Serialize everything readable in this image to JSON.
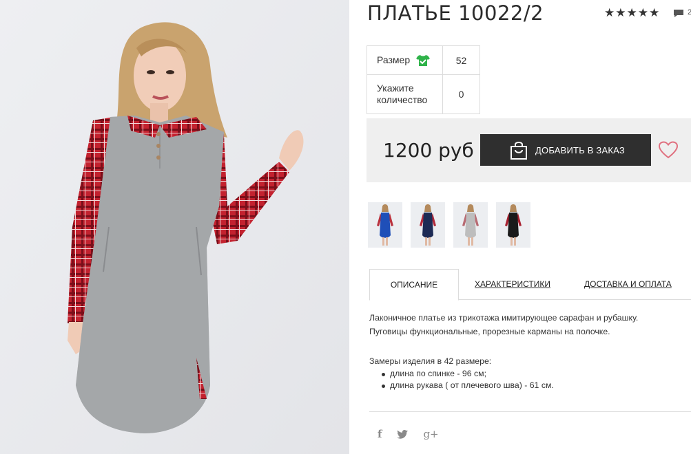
{
  "product": {
    "title": "ПЛАТЬЕ 10022/2",
    "rating_stars": "★★★★★",
    "comment_count": "2"
  },
  "options": {
    "size_label": "Размер",
    "size_value": "52",
    "quantity_label": "Укажите количество",
    "quantity_value": "0"
  },
  "purchase": {
    "price": "1200 руб",
    "add_button_label": "ДОБАВИТЬ В ЗАКАЗ"
  },
  "tabs": [
    {
      "label": "ОПИСАНИЕ"
    },
    {
      "label": "ХАРАКТЕРИСТИКИ"
    },
    {
      "label": "ДОСТАВКА И ОПЛАТА"
    }
  ],
  "description": {
    "line1": "Лаконичное платье из трикотажа имитирующее сарафан и рубашку.",
    "line2": "Пуговицы функциональные, прорезные карманы на полочке.",
    "measurements_title": "Замеры изделия в 42 размере:",
    "items": [
      "длина по спинке - 96 см;",
      "длина рукава ( от плечевого шва) - 61 см."
    ]
  },
  "social": {
    "facebook": "f",
    "twitter": "t",
    "googleplus": "g+"
  },
  "thumbnails": [
    {
      "dress_color": "#1f4fb8",
      "sleeve_color": "#b8323f"
    },
    {
      "dress_color": "#1d2b55",
      "sleeve_color": "#b0283a"
    },
    {
      "dress_color": "#bdbdbd",
      "sleeve_color": "#b86a72"
    },
    {
      "dress_color": "#1a1a1a",
      "sleeve_color": "#a8202f"
    }
  ],
  "colors": {
    "accent_green": "#2fb34a",
    "heart": "#e0707f",
    "button_bg": "#2f2f2f"
  }
}
